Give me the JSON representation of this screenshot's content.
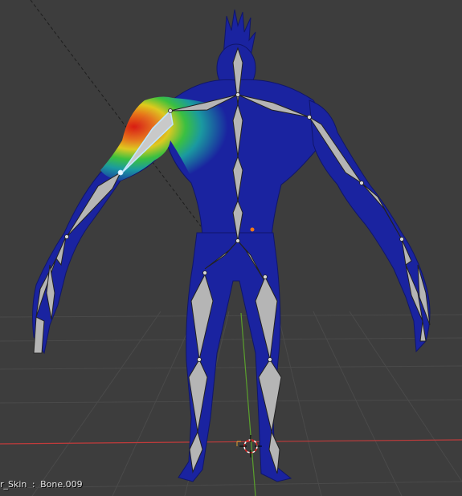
{
  "viewport": {
    "background_color": "#3d3d3d",
    "grid_color": "#4a4a4a",
    "x_axis_color": "#c23b3b",
    "y_axis_color": "#5aa02c",
    "mesh_color": "#1a23a0",
    "bone_color": "#b5b5b5",
    "active_bone_color": "#bfe6ff",
    "weight_gradient": [
      "#e11b0f",
      "#f07818",
      "#e8d21a",
      "#3cc83c",
      "#1aa0a0",
      "#1a23a0"
    ],
    "icons": {
      "cursor": "3d-cursor-icon",
      "origin": "object-origin-icon"
    }
  },
  "status": {
    "object": "r_Skin",
    "separator": ":",
    "bone": "Bone.009"
  }
}
